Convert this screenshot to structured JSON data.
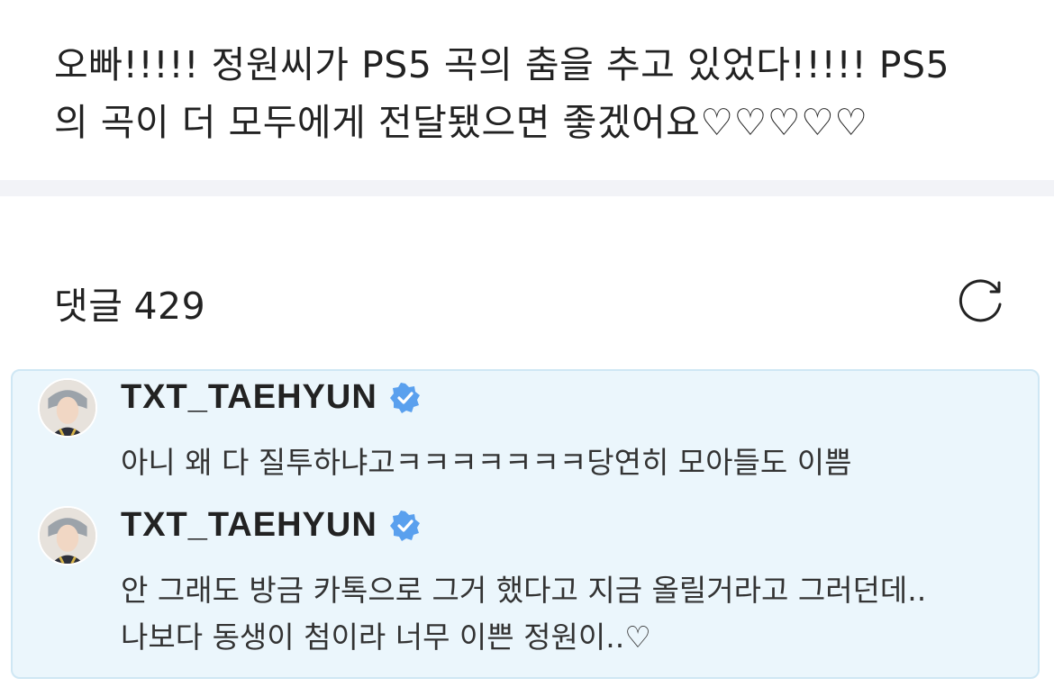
{
  "post": {
    "text": "오빠!!!!! 정원씨가 PS5 곡의 춤을 추고 있었다!!!!! PS5\n의 곡이 더 모두에게 전달됐으면 좋겠어요♡♡♡♡♡"
  },
  "comments": {
    "title": "댓글",
    "count": "429",
    "refresh_icon": "refresh-icon"
  },
  "artist_replies": [
    {
      "author": "TXT_TAEHYUN",
      "verified_icon": "verified-badge-icon",
      "text": "아니 왜 다 질투하냐고ㅋㅋㅋㅋㅋㅋㅋ당연히 모아들도 이쁨"
    },
    {
      "author": "TXT_TAEHYUN",
      "verified_icon": "verified-badge-icon",
      "text": "안 그래도 방금 카톡으로 그거 했다고 지금 올릴거라고 그러던데..\n나보다 동생이 첨이라 너무 이쁜 정원이..♡"
    }
  ],
  "colors": {
    "artist_box_bg": "#ebf6fc",
    "artist_box_border": "#cfe7f4",
    "verified_blue": "#5aa0ee",
    "divider": "#f2f3f7"
  }
}
